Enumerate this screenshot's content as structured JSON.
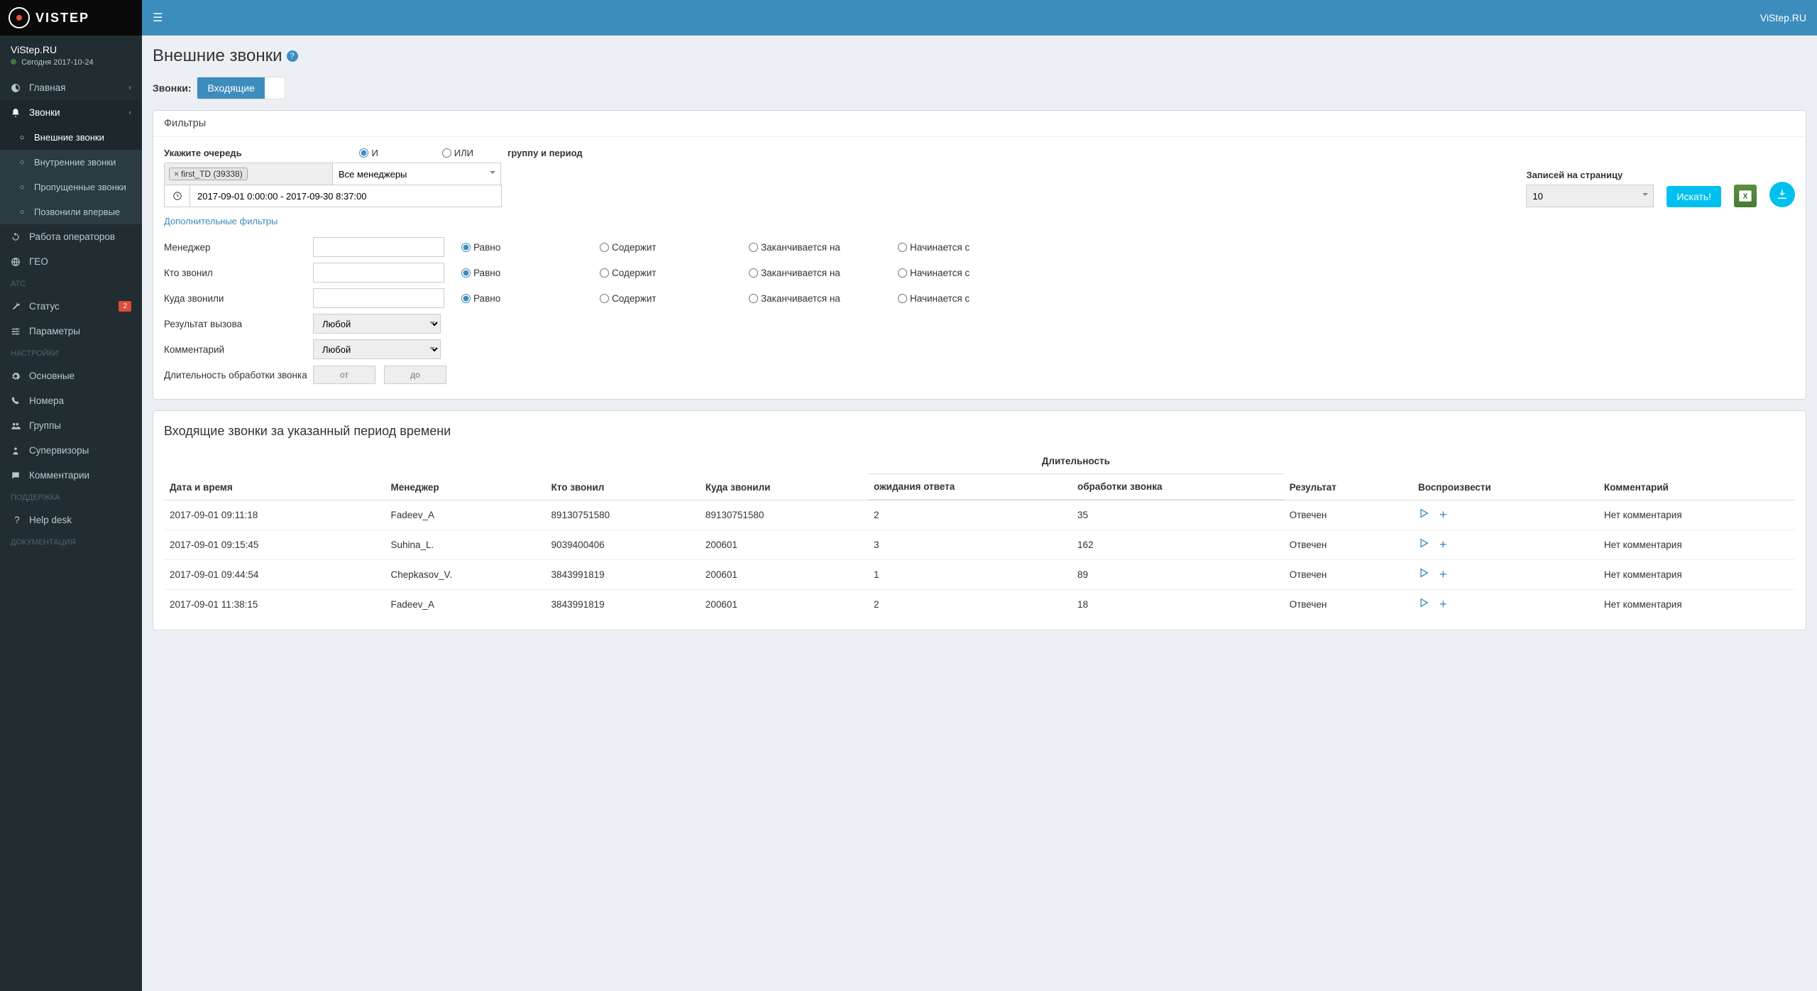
{
  "brand": {
    "name": "VISTEP",
    "right": "ViStep.RU"
  },
  "user": {
    "name": "ViStep.RU",
    "status_prefix": "Сегодня",
    "status_date": "2017-10-24"
  },
  "sidebar": {
    "main": {
      "label": "Главная"
    },
    "calls": {
      "label": "Звонки"
    },
    "calls_sub": {
      "external": "Внешние звонки",
      "internal": "Внутренние звонки",
      "missed": "Пропущенные звонки",
      "first": "Позвонили впервые"
    },
    "operators": "Работа операторов",
    "geo": "ГЕО",
    "atc_header": "АТС",
    "status": "Статус",
    "status_badge": "2",
    "params": "Параметры",
    "settings_header": "НАСТРОЙКИ",
    "basic": "Основные",
    "numbers": "Номера",
    "groups": "Группы",
    "supervisors": "Супервизоры",
    "comments": "Комментарии",
    "support_header": "ПОДДЕРЖКА",
    "helpdesk": "Help desk",
    "docs_header": "ДОКУМЕНТАЦИЯ"
  },
  "page": {
    "title": "Внешние звонки",
    "calls_label": "Звонки:",
    "incoming": "Входящие",
    "filters_title": "Фильтры",
    "queue_label": "Укажите очередь",
    "and": "И",
    "or": "ИЛИ",
    "group_period": "группу и период",
    "queue_tag": "first_TD (39338)",
    "managers_select": "Все менеджеры",
    "date_range": "2017-09-01 0:00:00 - 2017-09-30 8:37:00",
    "per_page_label": "Записей на страницу",
    "per_page_value": "10",
    "search_btn": "Искать!",
    "adv_filters_link": "Дополнительные фильтры",
    "af": {
      "manager": "Менеджер",
      "caller": "Кто звонил",
      "callee": "Куда звонили",
      "result": "Результат вызова",
      "comment": "Комментарий",
      "duration": "Длительность обработки звонка",
      "any": "Любой",
      "from": "от",
      "to": "до",
      "eq": "Равно",
      "contains": "Содержит",
      "endswith": "Заканчивается на",
      "startswith": "Начинается с"
    },
    "table_title": "Входящие звонки за указанный период времени"
  },
  "table": {
    "headers": {
      "datetime": "Дата и время",
      "manager": "Менеджер",
      "caller": "Кто звонил",
      "callee": "Куда звонили",
      "duration_group": "Длительность",
      "wait": "ожидания ответа",
      "talk": "обработки звонка",
      "result": "Результат",
      "play": "Воспроизвести",
      "comment": "Комментарий"
    },
    "rows": [
      {
        "dt": "2017-09-01 09:11:18",
        "mgr": "Fadeev_A",
        "from": "89130751580",
        "to": "89130751580",
        "wait": "2",
        "talk": "35",
        "res": "Отвечен",
        "cmt": "Нет комментария"
      },
      {
        "dt": "2017-09-01 09:15:45",
        "mgr": "Suhina_L.",
        "from": "9039400406",
        "to": "200601",
        "wait": "3",
        "talk": "162",
        "res": "Отвечен",
        "cmt": "Нет комментария"
      },
      {
        "dt": "2017-09-01 09:44:54",
        "mgr": "Chepkasov_V.",
        "from": "3843991819",
        "to": "200601",
        "wait": "1",
        "talk": "89",
        "res": "Отвечен",
        "cmt": "Нет комментария"
      },
      {
        "dt": "2017-09-01 11:38:15",
        "mgr": "Fadeev_A",
        "from": "3843991819",
        "to": "200601",
        "wait": "2",
        "talk": "18",
        "res": "Отвечен",
        "cmt": "Нет комментария"
      }
    ]
  }
}
